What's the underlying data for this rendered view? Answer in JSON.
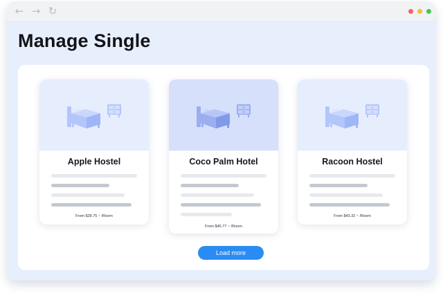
{
  "browser": {
    "back_icon": "←",
    "forward_icon": "→",
    "refresh_icon": "↻",
    "window_dots": [
      "#f46464",
      "#f6bd3b",
      "#3ec95b"
    ]
  },
  "page": {
    "title": "Manage Single"
  },
  "cards": [
    {
      "name": "Apple Hostel",
      "price": "From $28.75 ~ /Room"
    },
    {
      "name": "Coco Palm Hotel",
      "price": "From $45.77 ~ /Room"
    },
    {
      "name": "Racoon Hostel",
      "price": "From $43.32 ~ /Room"
    }
  ],
  "load_more": {
    "label": "Load more"
  },
  "colors": {
    "accent": "#2a8cf2",
    "app_background": "#e8effc",
    "card_image": "#e6edfd",
    "card_image_featured": "#d6e0fb",
    "icon_fill": "#b3c6fa",
    "icon_fill_featured": "#9aaef0"
  }
}
